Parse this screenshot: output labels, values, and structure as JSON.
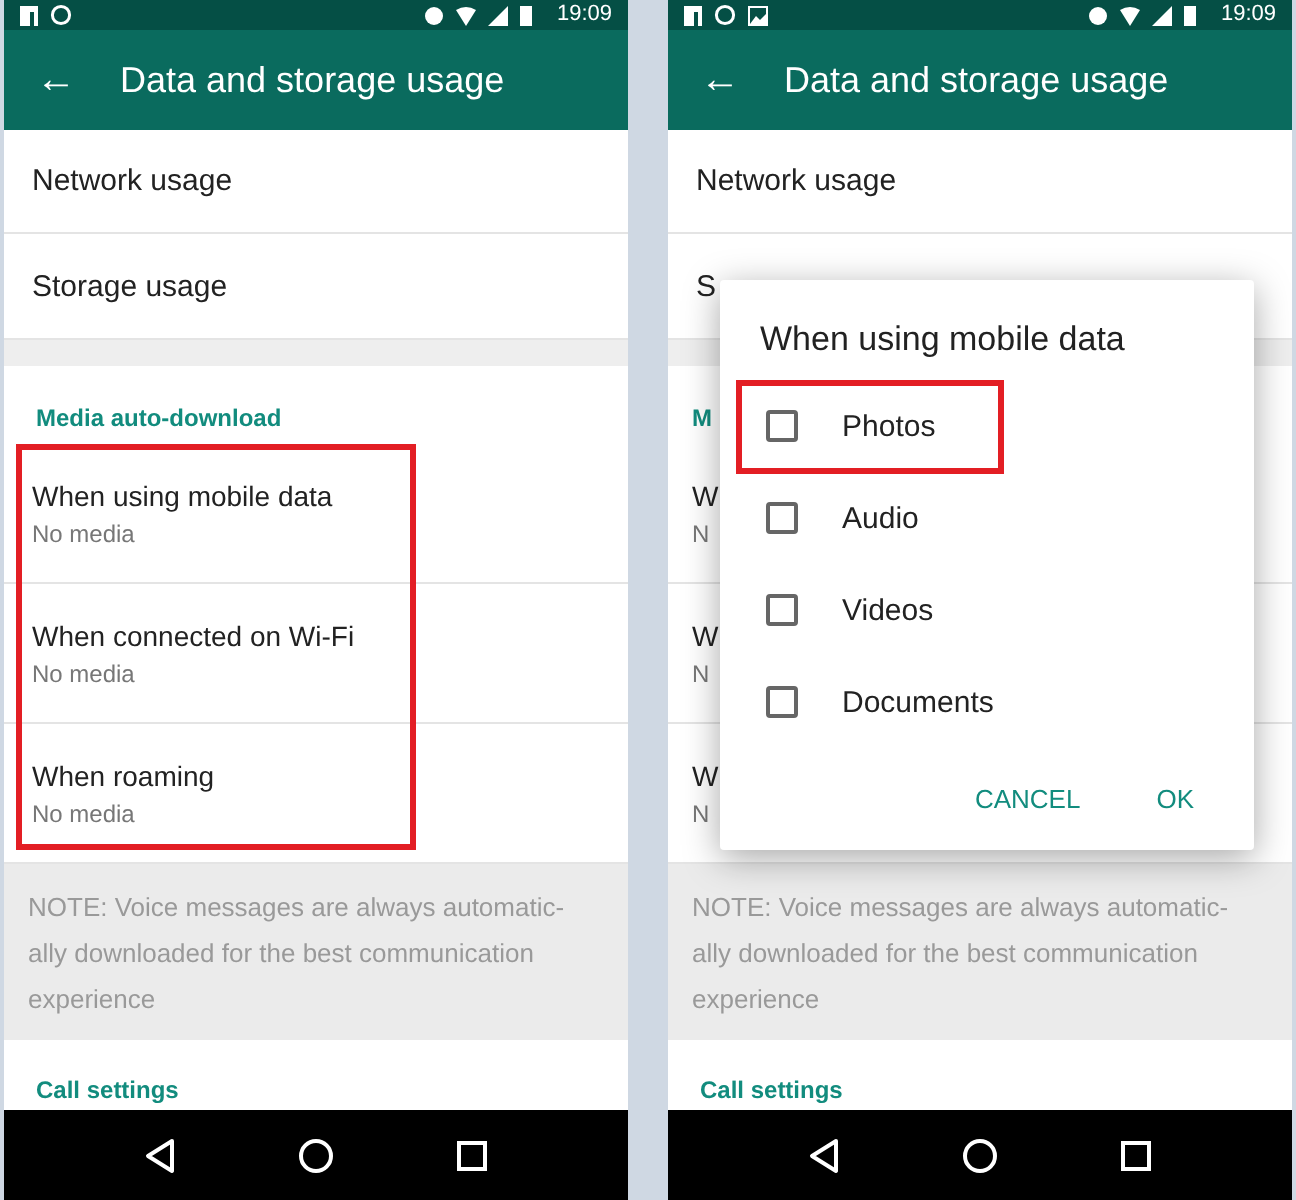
{
  "screens": [
    {
      "status_bar": {
        "time": "19:09",
        "notifications": [
          {
            "kind": "social"
          },
          {
            "kind": "chat"
          }
        ]
      },
      "toolbar": {
        "back": "←",
        "title": "Data and storage usage"
      },
      "items": [
        {
          "title": "Network usage"
        },
        {
          "title": "Storage usage"
        }
      ],
      "media_section": {
        "header": "Media auto-download",
        "highlighted": true,
        "rows": [
          {
            "title": "When using mobile data",
            "subtitle": "No media"
          },
          {
            "title": "When connected on Wi-Fi",
            "subtitle": "No media"
          },
          {
            "title": "When roaming",
            "subtitle": "No media"
          }
        ]
      },
      "note": "NOTE: Voice messages are always automatic-ally downloaded for the best communication experience",
      "call_settings_header": "Call settings"
    },
    {
      "status_bar": {
        "time": "19:09",
        "notifications": [
          {
            "kind": "social"
          },
          {
            "kind": "chat"
          },
          {
            "kind": "image"
          }
        ]
      },
      "toolbar": {
        "back": "←",
        "title": "Data and storage usage"
      },
      "items": [
        {
          "title": "Network usage"
        },
        {
          "title": "S"
        }
      ],
      "media_section": {
        "header": "M",
        "highlighted": false,
        "rows": [
          {
            "title": "W",
            "subtitle": "N"
          },
          {
            "title": "W",
            "subtitle": "N"
          },
          {
            "title": "W",
            "subtitle": "N"
          }
        ]
      },
      "note": "NOTE: Voice messages are always automatic-ally downloaded for the best communication experience",
      "call_settings_header": "Call settings",
      "dialog": {
        "title": "When using mobile data",
        "options": [
          {
            "label": "Photos",
            "checked": false,
            "highlighted": true
          },
          {
            "label": "Audio",
            "checked": false,
            "highlighted": false
          },
          {
            "label": "Videos",
            "checked": false,
            "highlighted": false
          },
          {
            "label": "Documents",
            "checked": false,
            "highlighted": false
          }
        ],
        "buttons": [
          "CANCEL",
          "OK"
        ]
      }
    }
  ]
}
